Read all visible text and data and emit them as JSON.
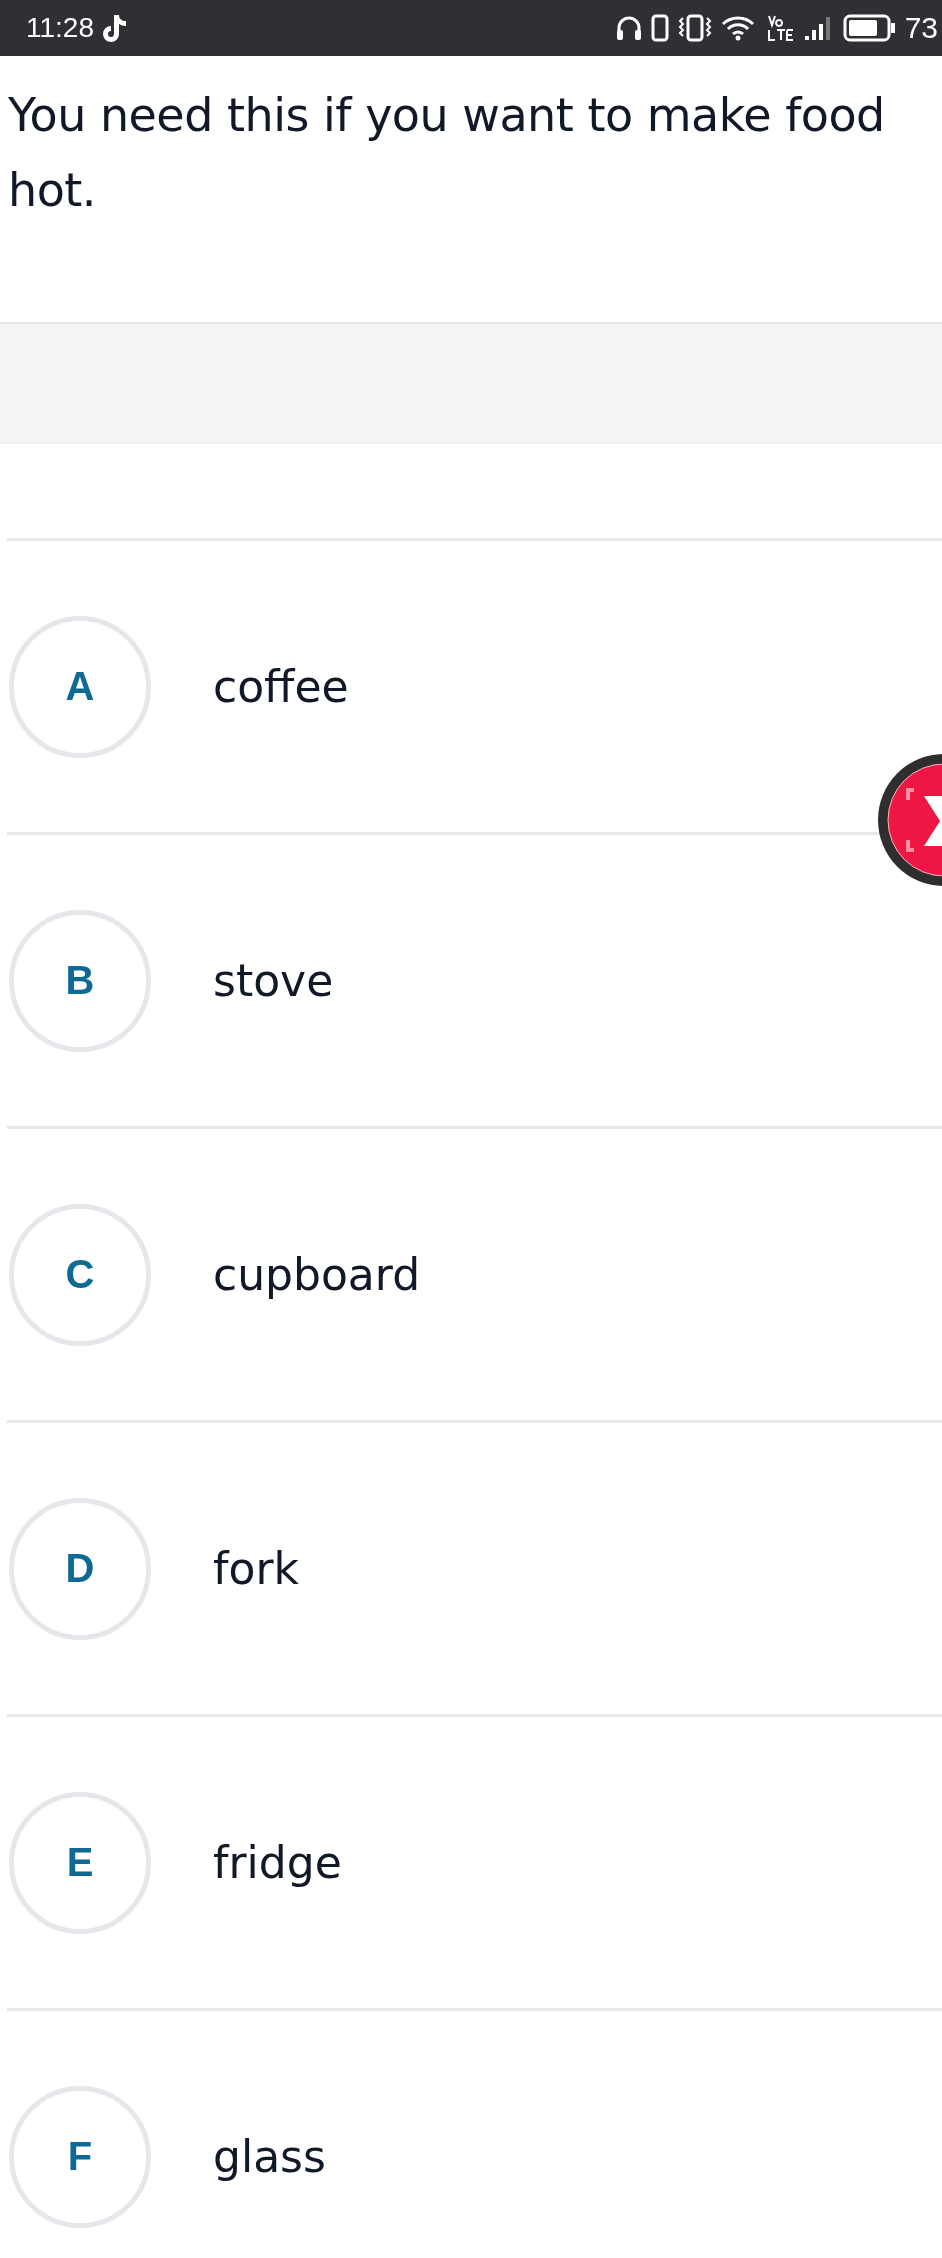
{
  "status_bar": {
    "time": "11:28",
    "battery": "73"
  },
  "question": "You need this if you want to make food hot.",
  "options": [
    {
      "letter": "A",
      "text": "coffee"
    },
    {
      "letter": "B",
      "text": "stove"
    },
    {
      "letter": "C",
      "text": "cupboard"
    },
    {
      "letter": "D",
      "text": "fork"
    },
    {
      "letter": "E",
      "text": "fridge"
    },
    {
      "letter": "F",
      "text": "glass"
    }
  ]
}
